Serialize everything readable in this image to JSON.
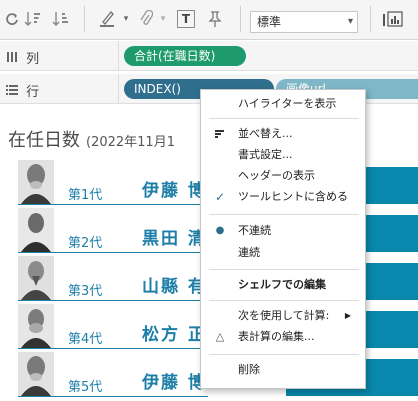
{
  "toolbar": {
    "fit_value": "標準",
    "fit_arrow": "▾",
    "text_button_label": "T"
  },
  "columns_shelf": {
    "label": "列",
    "icon": "columns-icon",
    "pill": "合計(在職日数)"
  },
  "rows_shelf": {
    "label": "行",
    "icon": "rows-icon",
    "pill_index": "INDEX()",
    "pill_second": "画像url"
  },
  "view": {
    "title": "在任日数",
    "subtitle": "(2022年11月1",
    "rows": [
      {
        "generation": "第1代",
        "name": "伊藤 博"
      },
      {
        "generation": "第2代",
        "name": "黒田 清"
      },
      {
        "generation": "第3代",
        "name": "山縣 有"
      },
      {
        "generation": "第4代",
        "name": "松方 正"
      },
      {
        "generation": "第5代",
        "name": "伊藤 博"
      }
    ]
  },
  "menu": {
    "items": [
      {
        "label": "ハイライターを表示"
      },
      {
        "label": "並べ替え..."
      },
      {
        "label": "書式設定..."
      },
      {
        "label": "ヘッダーの表示"
      },
      {
        "label": "ツールヒントに含める"
      },
      {
        "label": "不連続"
      },
      {
        "label": "連続"
      },
      {
        "label": "シェルフでの編集"
      },
      {
        "label": "次を使用して計算:"
      },
      {
        "label": "表計算の編集..."
      },
      {
        "label": "削除"
      }
    ],
    "check_mark": "✓",
    "selected_dot": "●",
    "delta_mark": "△",
    "submenu_arrow": "▶"
  },
  "colors": {
    "accent_blue": "#1d7fa8",
    "bar_blue": "#0987ac",
    "pill_green": "#1e9b6d",
    "pill_blue": "#2f6e8c"
  }
}
